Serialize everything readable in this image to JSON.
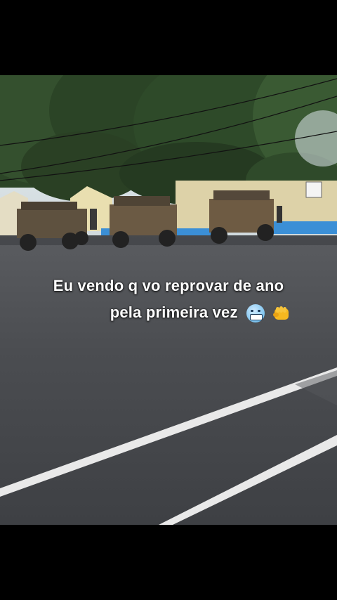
{
  "caption": {
    "line1": "Eu vendo q vo reprovar de ano",
    "line2": "pela primeira vez"
  },
  "emojis": [
    "cold-face-icon",
    "fist-icon"
  ],
  "colors": {
    "asphalt": "#4a4c50",
    "sky": "#dfe8ec",
    "foliage": "#2f4a2a",
    "vehicle": "#6a5a44",
    "wall_blue": "#3b8fd6"
  }
}
